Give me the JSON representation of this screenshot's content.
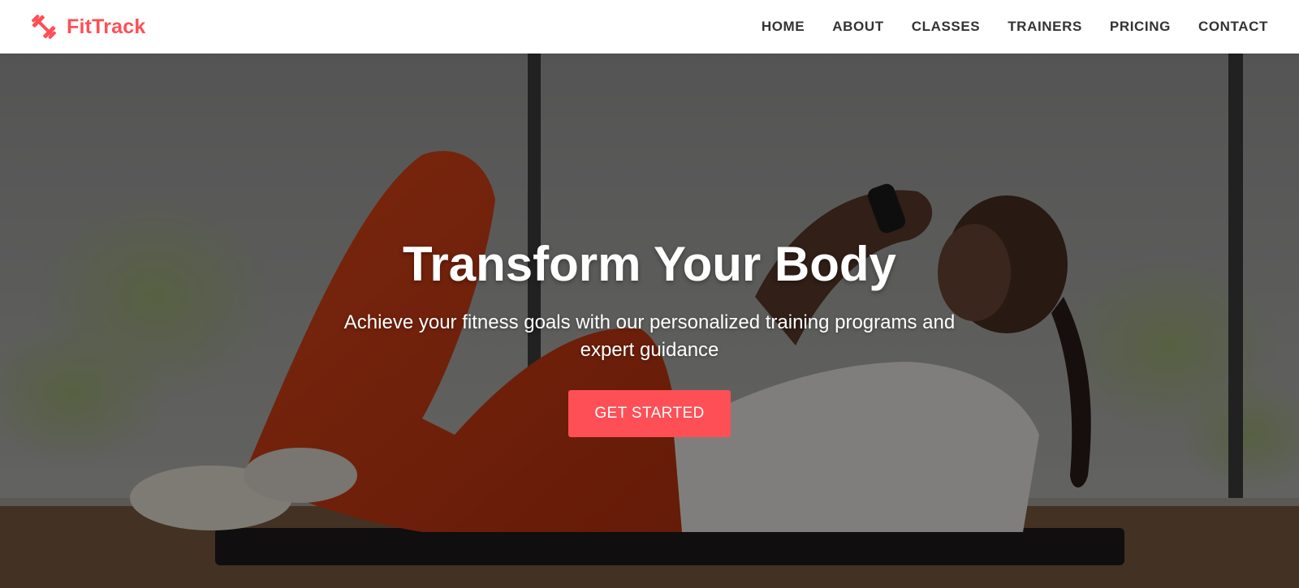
{
  "brand": {
    "name": "FitTrack",
    "icon": "dumbbell-icon",
    "color": "#ff4f56"
  },
  "nav": {
    "items": [
      {
        "label": "HOME"
      },
      {
        "label": "ABOUT"
      },
      {
        "label": "CLASSES"
      },
      {
        "label": "TRAINERS"
      },
      {
        "label": "PRICING"
      },
      {
        "label": "CONTACT"
      }
    ]
  },
  "hero": {
    "title": "Transform Your Body",
    "subtitle": "Achieve your fitness goals with our personalized training programs and expert guidance",
    "cta_label": "GET STARTED",
    "cta_color": "#ff4f56",
    "background": "photo of a woman doing crunches on a mat in a bright gym"
  }
}
